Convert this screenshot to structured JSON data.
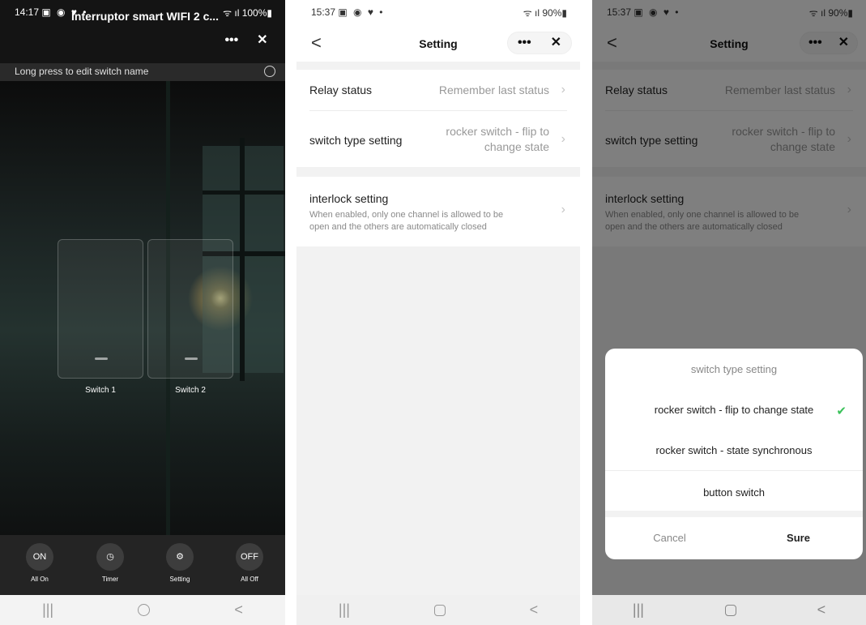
{
  "screen1": {
    "status": {
      "time": "14:17",
      "left_icons": "▣ ◉ ♥ •",
      "right": "ᯤ ıl 100%▮"
    },
    "title": "Interruptor smart WIFI 2 c...",
    "more_label": "•••",
    "close_label": "✕",
    "hint": "Long press to edit switch name",
    "switches": [
      "Switch 1",
      "Switch 2"
    ],
    "toolbar": [
      {
        "icon_text": "ON",
        "label": "All On"
      },
      {
        "icon_text": "◷",
        "label": "Timer"
      },
      {
        "icon_text": "⚙",
        "label": "Setting"
      },
      {
        "icon_text": "OFF",
        "label": "All Off"
      }
    ]
  },
  "screen2": {
    "status": {
      "time": "15:37",
      "left_icons": "▣ ◉ ♥ •",
      "right": "ᯤ ıl 90%▮"
    },
    "back_label": "<",
    "title": "Setting",
    "more_label": "•••",
    "close_label": "✕",
    "relay_status": {
      "label": "Relay status",
      "value": "Remember last status"
    },
    "switch_type": {
      "label": "switch type setting",
      "value_line1": "rocker switch - flip to",
      "value_line2": "change state"
    },
    "interlock": {
      "label": "interlock setting",
      "desc_line1": "When enabled, only one channel is allowed to be",
      "desc_line2": "open and the others are automatically closed"
    }
  },
  "screen3": {
    "status": {
      "time": "15:37",
      "left_icons": "▣ ◉ ♥ •",
      "right": "ᯤ ıl 90%▮"
    },
    "back_label": "<",
    "title": "Setting",
    "more_label": "•••",
    "close_label": "✕",
    "relay_status": {
      "label": "Relay status",
      "value": "Remember last status"
    },
    "switch_type": {
      "label": "switch type setting",
      "value_line1": "rocker switch - flip to",
      "value_line2": "change state"
    },
    "interlock": {
      "label": "interlock setting",
      "desc_line1": "When enabled, only one channel is allowed to be",
      "desc_line2": "open and the others are automatically closed"
    },
    "sheet": {
      "title": "switch type setting",
      "options": [
        "rocker switch - flip to change state",
        "rocker switch - state synchronous",
        "button switch"
      ],
      "selected_check": "✔",
      "cancel": "Cancel",
      "sure": "Sure"
    }
  },
  "nav": {
    "recents": "|||",
    "back": "<"
  },
  "colors": {
    "check_green": "#3cc25b",
    "dark_bg": "#141414",
    "settings_bg": "#f2f2f2"
  }
}
